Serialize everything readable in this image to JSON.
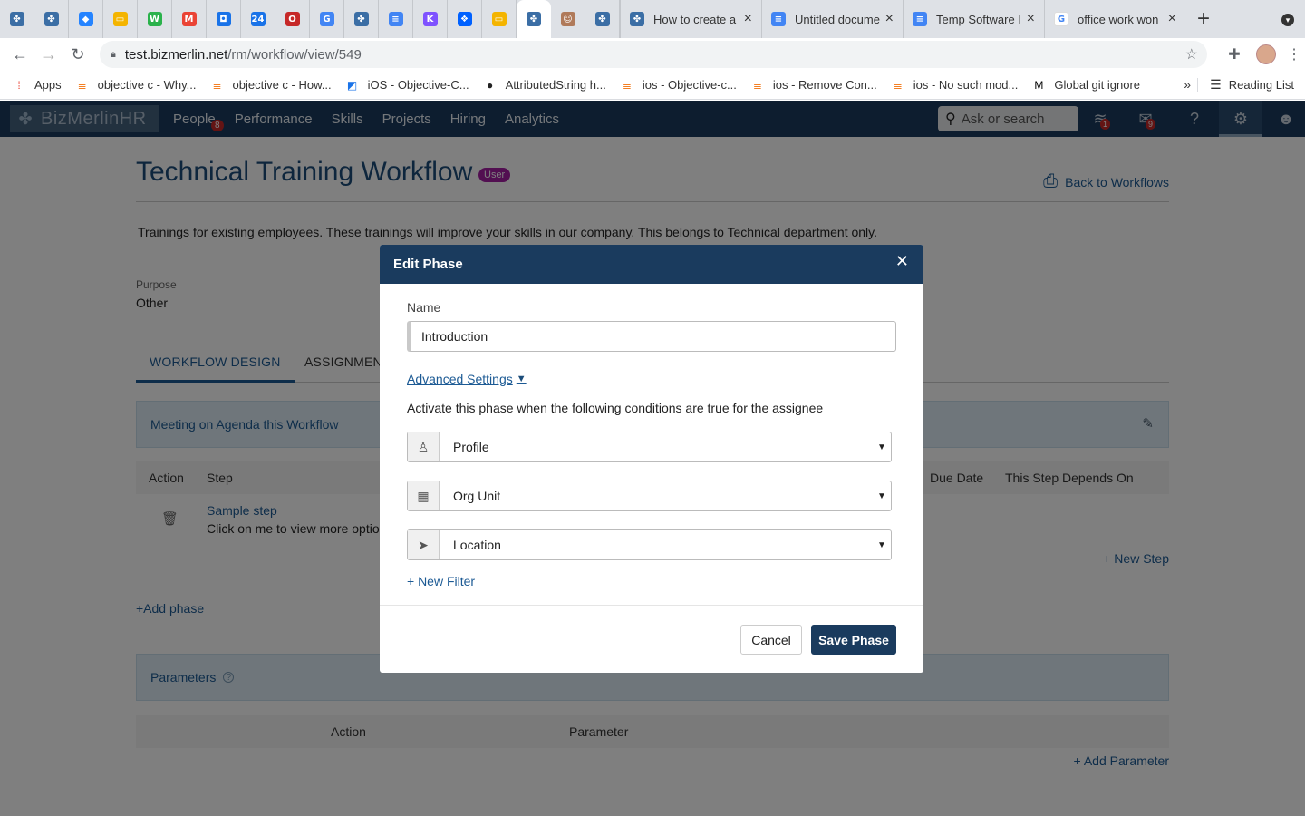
{
  "browser": {
    "pinned_tabs": [
      {
        "icon": "bizmerlin-icon",
        "color": "#3b6ea5",
        "glyph": "✤"
      },
      {
        "icon": "bizmerlin-icon",
        "color": "#3b6ea5",
        "glyph": "✤"
      },
      {
        "icon": "jira-icon",
        "color": "#2684ff",
        "glyph": "◆"
      },
      {
        "icon": "google-slides-icon",
        "color": "#f4b400",
        "glyph": "▭"
      },
      {
        "icon": "feedly-icon",
        "color": "#2bb24c",
        "glyph": "W"
      },
      {
        "icon": "gmail-icon",
        "color": "#ea4335",
        "glyph": "M"
      },
      {
        "icon": "pocket-icon",
        "color": "#1a73e8",
        "glyph": "◘"
      },
      {
        "icon": "google-calendar-icon",
        "color": "#1a73e8",
        "glyph": "24"
      },
      {
        "icon": "opera-icon",
        "color": "#c62828",
        "glyph": "O"
      },
      {
        "icon": "google-translate-icon",
        "color": "#4285f4",
        "glyph": "G"
      },
      {
        "icon": "bizmerlin-icon",
        "color": "#3b6ea5",
        "glyph": "✤"
      },
      {
        "icon": "google-docs-icon",
        "color": "#4285f4",
        "glyph": "≡"
      },
      {
        "icon": "kotlin-icon",
        "color": "#7f52ff",
        "glyph": "K"
      },
      {
        "icon": "dropbox-icon",
        "color": "#0061ff",
        "glyph": "❖"
      },
      {
        "icon": "google-slides-icon",
        "color": "#f4b400",
        "glyph": "▭"
      },
      {
        "icon": "bizmerlin-icon",
        "color": "#3b6ea5",
        "glyph": "✤"
      },
      {
        "icon": "avatar-icon",
        "color": "#b07a5a",
        "glyph": "☺"
      },
      {
        "icon": "bizmerlin-icon",
        "color": "#3b6ea5",
        "glyph": "✤"
      }
    ],
    "tabs": [
      {
        "title": "How to create a",
        "icon": "bizmerlin-icon",
        "color": "#3b6ea5",
        "glyph": "✤"
      },
      {
        "title": "Untitled docume",
        "icon": "google-docs-icon",
        "color": "#4285f4",
        "glyph": "≡"
      },
      {
        "title": "Temp Software I",
        "icon": "google-docs-icon",
        "color": "#4285f4",
        "glyph": "≡"
      },
      {
        "title": "office work won",
        "icon": "google-icon",
        "color": "#ffffff",
        "glyph": "G"
      }
    ],
    "url_host": "test.bizmerlin.net",
    "url_path": "/rm/workflow/view/549",
    "bookmarks": [
      {
        "label": "Apps",
        "icon": "apps-grid-icon"
      },
      {
        "label": "objective c - Why...",
        "icon": "stackoverflow-icon"
      },
      {
        "label": "objective c - How...",
        "icon": "stackoverflow-icon"
      },
      {
        "label": "iOS - Objective-C...",
        "icon": "bookmark-icon"
      },
      {
        "label": "AttributedString h...",
        "icon": "github-icon"
      },
      {
        "label": "ios - Objective-c...",
        "icon": "stackoverflow-icon"
      },
      {
        "label": "ios - Remove Con...",
        "icon": "stackoverflow-icon"
      },
      {
        "label": "ios - No such mod...",
        "icon": "stackoverflow-icon"
      },
      {
        "label": "Global git ignore",
        "icon": "medium-icon"
      }
    ],
    "reading_list": "Reading List"
  },
  "app": {
    "logo_text": "BizMerlinHR",
    "nav": [
      "People",
      "Performance",
      "Skills",
      "Projects",
      "Hiring",
      "Analytics"
    ],
    "people_badge": "8",
    "search_placeholder": "Ask or search",
    "inbox_badge": "1",
    "mail_badge": "9"
  },
  "page": {
    "title": "Technical Training Workflow",
    "badge": "User",
    "back_link": "Back to Workflows",
    "description": "Trainings for existing employees. These trainings will improve your skills in our company. This belongs to Technical department only.",
    "purpose_label": "Purpose",
    "purpose_value": "Other",
    "tabs": [
      "WORKFLOW DESIGN",
      "ASSIGNMENT"
    ],
    "phase_header": "Meeting on Agenda this Workflow",
    "step_columns": {
      "action": "Action",
      "step": "Step",
      "due_date": "Due Date",
      "depends": "This Step Depends On"
    },
    "step_name": "Sample step",
    "step_desc": "Click on me to view more optio",
    "new_step": "+ New Step",
    "add_phase": "+Add phase",
    "parameters_header": "Parameters",
    "param_columns": {
      "action": "Action",
      "parameter": "Parameter"
    },
    "add_parameter": "+ Add Parameter"
  },
  "modal": {
    "title": "Edit Phase",
    "name_label": "Name",
    "name_value": "Introduction",
    "advanced_settings": "Advanced Settings",
    "conditions_text": "Activate this phase when the following conditions are true for the assignee",
    "filters": [
      {
        "value": "Profile",
        "icon": "profile-icon"
      },
      {
        "value": "Org Unit",
        "icon": "building-icon"
      },
      {
        "value": "Location",
        "icon": "location-arrow-icon"
      }
    ],
    "new_filter": "+ New Filter",
    "cancel": "Cancel",
    "save": "Save Phase"
  }
}
